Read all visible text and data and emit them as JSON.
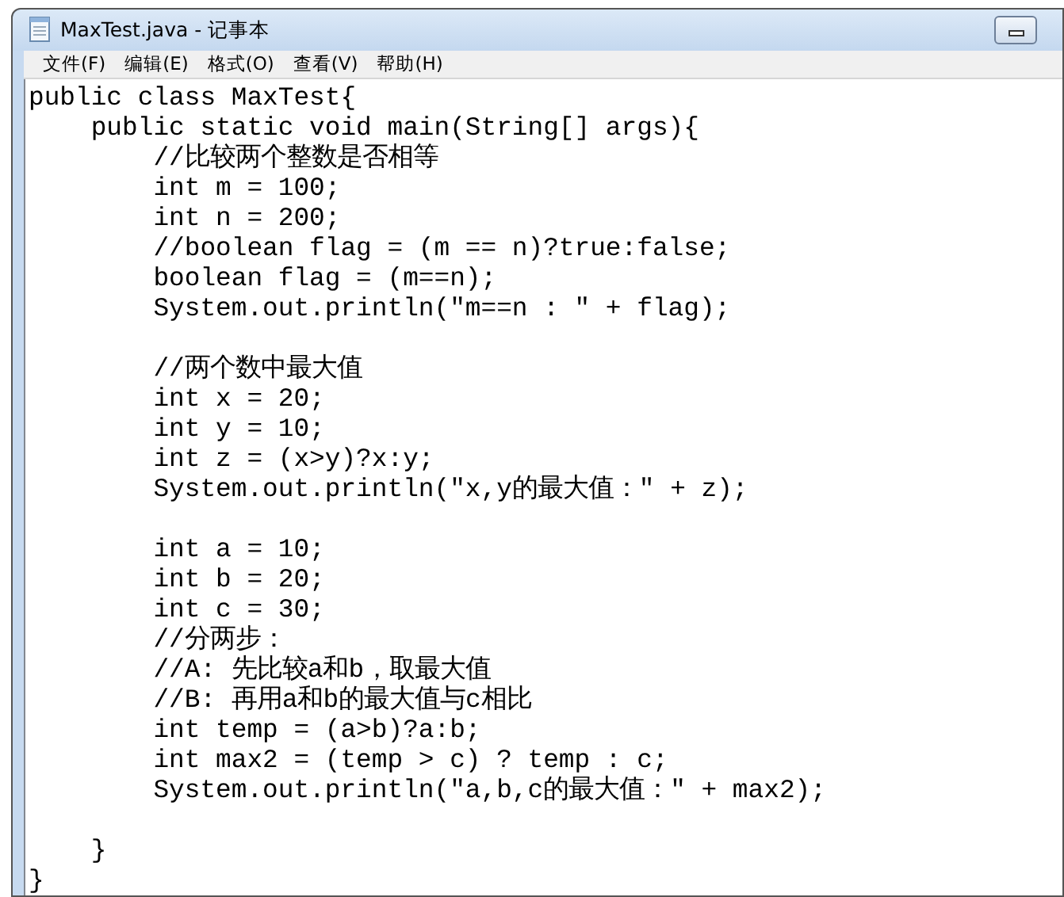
{
  "window": {
    "title": "MaxTest.java - 记事本"
  },
  "menu": [
    "文件(F)",
    "编辑(E)",
    "格式(O)",
    "查看(V)",
    "帮助(H)"
  ],
  "editor": {
    "lines": [
      {
        "kind": "code",
        "text": "public class MaxTest{"
      },
      {
        "kind": "code",
        "text": "    public static void main(String[] args){"
      },
      {
        "kind": "code",
        "text": "        //比较两个整数是否相等"
      },
      {
        "kind": "code",
        "text": "        int m = 100;"
      },
      {
        "kind": "code",
        "text": "        int n = 200;"
      },
      {
        "kind": "code",
        "text": "        //boolean flag = (m == n)?true:false;"
      },
      {
        "kind": "code",
        "text": "        boolean flag = (m==n);"
      },
      {
        "kind": "code",
        "text": "        System.out.println(\"m==n : \" + flag);"
      },
      {
        "kind": "blank"
      },
      {
        "kind": "code",
        "text": "        //两个数中最大值"
      },
      {
        "kind": "code",
        "text": "        int x = 20;"
      },
      {
        "kind": "code",
        "text": "        int y = 10;"
      },
      {
        "kind": "code",
        "text": "        int z = (x>y)?x:y;"
      },
      {
        "kind": "code",
        "text": "        System.out.println(\"x,y的最大值：\" + z);"
      },
      {
        "kind": "blank"
      },
      {
        "kind": "code",
        "text": "        int a = 10;"
      },
      {
        "kind": "code",
        "text": "        int b = 20;"
      },
      {
        "kind": "code",
        "text": "        int c = 30;"
      },
      {
        "kind": "code",
        "text": "        //分两步："
      },
      {
        "kind": "code",
        "text": "        //A: 先比较a和b，取最大值"
      },
      {
        "kind": "code",
        "text": "        //B: 再用a和b的最大值与c相比"
      },
      {
        "kind": "code",
        "text": "        int temp = (a>b)?a:b;"
      },
      {
        "kind": "code",
        "text": "        int max2 = (temp > c) ? temp : c;"
      },
      {
        "kind": "code",
        "text": "        System.out.println(\"a,b,c的最大值：\" + max2);"
      },
      {
        "kind": "blank"
      },
      {
        "kind": "code",
        "text": "    }"
      },
      {
        "kind": "code",
        "text": "}"
      }
    ]
  }
}
